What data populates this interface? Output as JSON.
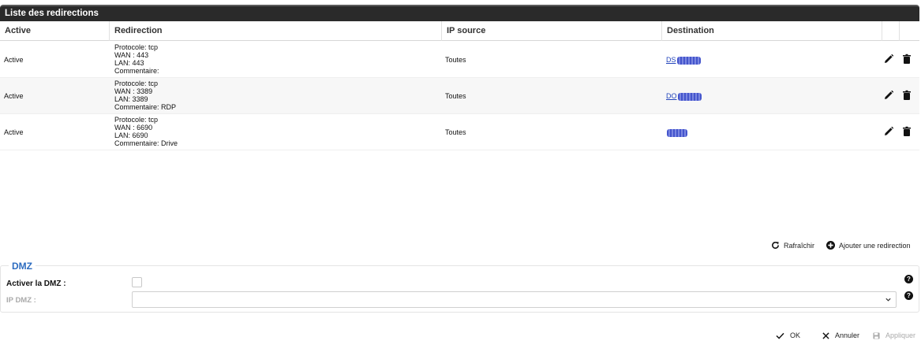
{
  "panel": {
    "title": "Liste des redirections"
  },
  "table": {
    "headers": [
      "Active",
      "Redirection",
      "IP source",
      "Destination"
    ],
    "rows": [
      {
        "active": "Active",
        "protocol": "Protocole: tcp",
        "wan": "WAN : 443",
        "lan": "LAN: 443",
        "comment": "Commentaire:",
        "source": "Toutes",
        "destination": "DS"
      },
      {
        "active": "Active",
        "protocol": "Protocole: tcp",
        "wan": "WAN : 3389",
        "lan": "LAN: 3389",
        "comment": "Commentaire: RDP",
        "source": "Toutes",
        "destination": "DO"
      },
      {
        "active": "Active",
        "protocol": "Protocole: tcp",
        "wan": "WAN : 6690",
        "lan": "LAN: 6690",
        "comment": "Commentaire: Drive",
        "source": "Toutes",
        "destination": ""
      }
    ]
  },
  "toolbar": {
    "refresh_label": "Rafraîchir",
    "add_label": "Ajouter une redirection"
  },
  "dmz": {
    "title": "DMZ",
    "enable_label": "Activer la DMZ :",
    "enabled": false,
    "ip_label": "IP DMZ :",
    "ip_value": ""
  },
  "footer": {
    "ok_label": "OK",
    "cancel_label": "Annuler",
    "apply_label": "Appliquer"
  },
  "colors": {
    "header_bg": "#2a2a2a",
    "accent": "#2d6cc0",
    "link": "#2244bb"
  },
  "icons": [
    "edit-icon",
    "trash-icon",
    "refresh-icon",
    "plus-circle-icon",
    "help-icon",
    "chevron-down-icon",
    "check-icon",
    "close-icon",
    "save-icon"
  ]
}
